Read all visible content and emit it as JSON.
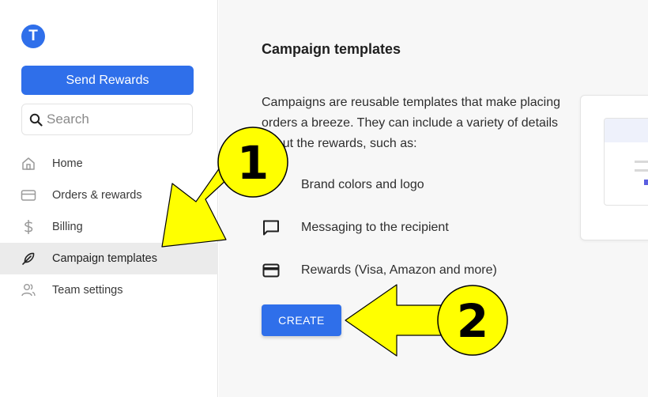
{
  "sidebar": {
    "logo_letter": "T",
    "send_button": "Send Rewards",
    "search_placeholder": "Search",
    "items": [
      {
        "label": "Home",
        "icon": "home-icon"
      },
      {
        "label": "Orders & rewards",
        "icon": "card-icon"
      },
      {
        "label": "Billing",
        "icon": "dollar-icon"
      },
      {
        "label": "Campaign templates",
        "icon": "feather-icon",
        "active": true
      },
      {
        "label": "Team settings",
        "icon": "team-icon"
      }
    ]
  },
  "main": {
    "title": "Campaign templates",
    "description": "Campaigns are reusable templates that make placing orders a breeze. They can include a variety of details about the rewards, such as:",
    "features": [
      {
        "label": "Brand colors and logo",
        "icon": "palette-icon"
      },
      {
        "label": "Messaging to the recipient",
        "icon": "message-icon"
      },
      {
        "label": "Rewards (Visa, Amazon and more)",
        "icon": "credit-card-icon"
      }
    ],
    "create_button": "CREATE"
  },
  "annotations": {
    "badge_1": "1",
    "badge_2": "2",
    "color": "#ffff00"
  },
  "colors": {
    "accent": "#2f6fea",
    "active_nav_bg": "#ebebeb",
    "main_bg": "#f7f7f7"
  }
}
